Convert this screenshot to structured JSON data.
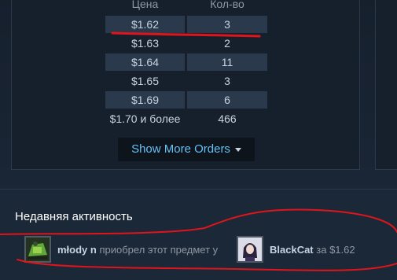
{
  "orders": {
    "headers": {
      "price": "Цена",
      "quantity": "Кол-во"
    },
    "rows": [
      {
        "price": "$1.62",
        "quantity": "3",
        "shaded": true
      },
      {
        "price": "$1.63",
        "quantity": "2",
        "shaded": false
      },
      {
        "price": "$1.64",
        "quantity": "11",
        "shaded": true
      },
      {
        "price": "$1.65",
        "quantity": "3",
        "shaded": false
      },
      {
        "price": "$1.69",
        "quantity": "6",
        "shaded": true
      },
      {
        "price": "$1.70 и более",
        "quantity": "466",
        "shaded": false
      }
    ],
    "show_more_label": "Show More Orders"
  },
  "recent_activity": {
    "title": "Недавняя активность",
    "entry": {
      "buyer": "młody n",
      "action_text": "приобрел этот предмет у",
      "seller": "BlackCat",
      "price_text": "за $1.62"
    }
  },
  "colors": {
    "background": "#1b2838",
    "panel": "#16202d",
    "row_shade": "#2a3a4c",
    "accent_link": "#66c0f4",
    "annotation": "#e0141b"
  },
  "icons": {
    "show_more": "caret-down-icon"
  }
}
